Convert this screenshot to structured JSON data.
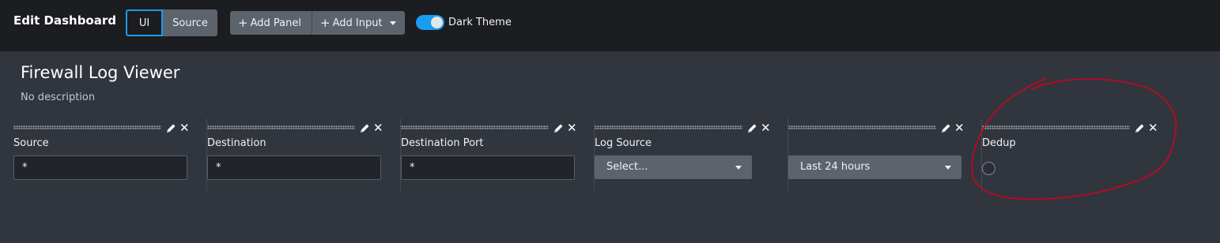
{
  "header": {
    "title": "Edit Dashboard",
    "mode_tabs": [
      {
        "label": "UI",
        "active": true
      },
      {
        "label": "Source",
        "active": false
      }
    ],
    "add_panel_label": "Add Panel",
    "add_input_label": "Add Input",
    "theme_toggle": {
      "label": "Dark Theme",
      "on": true
    }
  },
  "dashboard": {
    "title": "Firewall Log Viewer",
    "description": "No description"
  },
  "inputs": [
    {
      "type": "text",
      "label": "Source",
      "value": "*"
    },
    {
      "type": "text",
      "label": "Destination",
      "value": "*"
    },
    {
      "type": "text",
      "label": "Destination Port",
      "value": "*"
    },
    {
      "type": "dropdown",
      "label": "Log Source",
      "value": "Select..."
    },
    {
      "type": "time",
      "label": "",
      "value": "Last 24 hours"
    },
    {
      "type": "radio",
      "label": "Dedup",
      "value": ""
    }
  ],
  "colors": {
    "accent": "#1a9cf0",
    "topbar_bg": "#1b1d20",
    "page_bg": "#31363e",
    "button_bg": "#5c636c",
    "annotation": "#d0021b"
  },
  "icons": {
    "edit": "pencil-icon",
    "remove": "close-icon",
    "drag": "drag-handle-icon",
    "dropdown": "chevron-down-icon"
  }
}
